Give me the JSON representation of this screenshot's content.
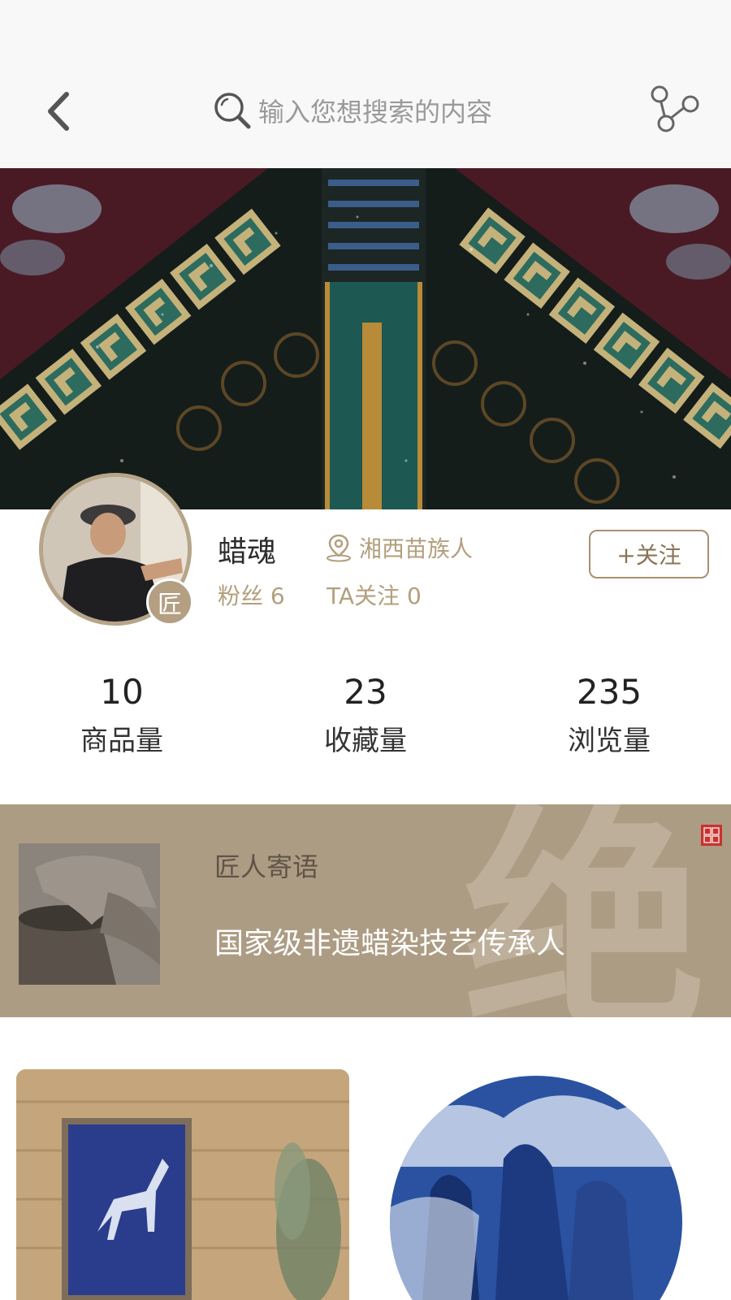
{
  "header": {
    "search_placeholder": "输入您想搜索的内容",
    "icons": {
      "back": "chevron-left-icon",
      "search": "search-icon",
      "share": "share-icon"
    }
  },
  "banner": {
    "description_icon": "batik-embroidery-banner"
  },
  "profile": {
    "name": "蜡魂",
    "badge": "匠",
    "location": "湘西苗族人",
    "fans": "粉丝 6",
    "following": "TA关注 0",
    "follow_button": "+关注"
  },
  "stats": [
    {
      "value": "10",
      "label": "商品量"
    },
    {
      "value": "23",
      "label": "收藏量"
    },
    {
      "value": "235",
      "label": "浏览量"
    }
  ],
  "message": {
    "title": "匠人寄语",
    "text": "国家级非遗蜡染技艺传承人",
    "watermark": "绝"
  },
  "colors": {
    "accent": "#b39f7d",
    "message_band": "#ad9c84",
    "header_bg": "#f8f8f8",
    "indigo": "#2a3f8f"
  }
}
